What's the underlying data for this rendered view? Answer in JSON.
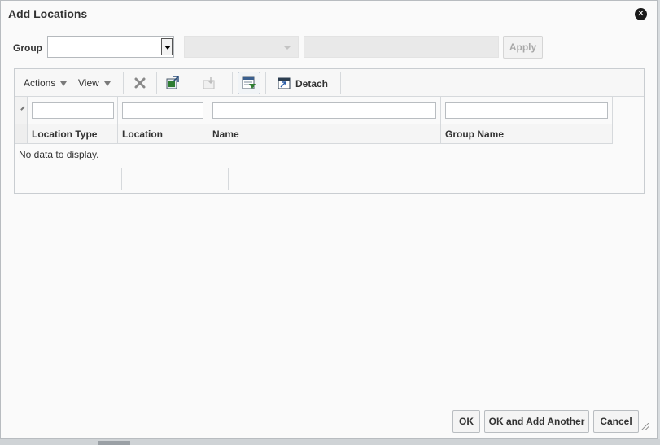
{
  "dialog": {
    "title": "Add Locations",
    "close_icon": "close-circle-icon"
  },
  "filter": {
    "group_label": "Group",
    "group_value": "",
    "subgroup_value": "",
    "search_value": "",
    "apply_label": "Apply"
  },
  "toolbar": {
    "actions_label": "Actions",
    "view_label": "View",
    "delete_icon": "delete-x-icon",
    "export_icon": "export-excel-icon",
    "import_icon": "import-icon",
    "query_by_example_icon": "query-by-example-icon",
    "detach_label": "Detach",
    "detach_icon": "detach-icon"
  },
  "table": {
    "columns": [
      "Location Type",
      "Location",
      "Name",
      "Group Name"
    ],
    "filters": [
      "",
      "",
      "",
      ""
    ],
    "empty_message": "No data to display."
  },
  "buttons": {
    "ok": "OK",
    "ok_add_another": "OK and Add Another",
    "cancel": "Cancel"
  },
  "colors": {
    "accent_border": "#5a6f86",
    "dialog_bg": "#fafafa"
  }
}
